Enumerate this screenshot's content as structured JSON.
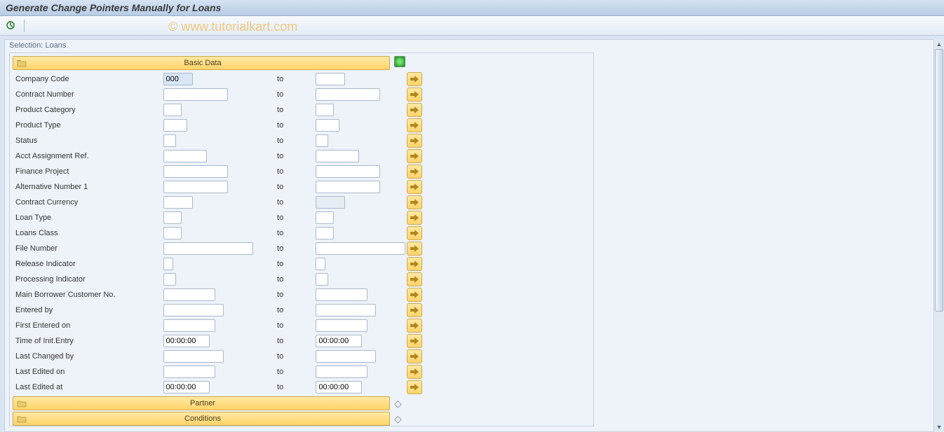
{
  "title": "Generate Change Pointers Manually for Loans",
  "watermark": "© www.tutorialkart.com",
  "group": {
    "title": "Selection: Loans",
    "sections": {
      "basic_data": {
        "label": "Basic Data",
        "expanded": true
      },
      "partner": {
        "label": "Partner",
        "expanded": false
      },
      "conditions": {
        "label": "Conditions",
        "expanded": false
      }
    }
  },
  "to_label": "to",
  "rows": {
    "company_code": {
      "label": "Company Code",
      "from": "000",
      "to": "",
      "wfrom": 42,
      "wto": 42
    },
    "contract_number": {
      "label": "Contract Number",
      "from": "",
      "to": "",
      "wfrom": 92,
      "wto": 92
    },
    "product_category": {
      "label": "Product Category",
      "from": "",
      "to": "",
      "wfrom": 26,
      "wto": 26
    },
    "product_type": {
      "label": "Product Type",
      "from": "",
      "to": "",
      "wfrom": 34,
      "wto": 34
    },
    "status": {
      "label": "Status",
      "from": "",
      "to": "",
      "wfrom": 18,
      "wto": 18
    },
    "acct_assign": {
      "label": "Acct Assignment Ref.",
      "from": "",
      "to": "",
      "wfrom": 62,
      "wto": 62
    },
    "finance_project": {
      "label": "Finance Project",
      "from": "",
      "to": "",
      "wfrom": 92,
      "wto": 92
    },
    "alt_number1": {
      "label": "Alternative Number 1",
      "from": "",
      "to": "",
      "wfrom": 92,
      "wto": 92
    },
    "contract_curr": {
      "label": "Contract Currency",
      "from": "",
      "to": "",
      "wfrom": 42,
      "wto": 42,
      "to_disabled": true
    },
    "loan_type": {
      "label": "Loan Type",
      "from": "",
      "to": "",
      "wfrom": 26,
      "wto": 26
    },
    "loans_class": {
      "label": "Loans Class",
      "from": "",
      "to": "",
      "wfrom": 26,
      "wto": 26
    },
    "file_number": {
      "label": "File Number",
      "from": "",
      "to": "",
      "wfrom": 128,
      "wto": 128
    },
    "release_ind": {
      "label": "Release Indicator",
      "from": "",
      "to": "",
      "wfrom": 14,
      "wto": 14
    },
    "processing_ind": {
      "label": "Processing Indicator",
      "from": "",
      "to": "",
      "wfrom": 18,
      "wto": 18
    },
    "main_borrower": {
      "label": "Main Borrower Customer No.",
      "from": "",
      "to": "",
      "wfrom": 74,
      "wto": 74
    },
    "entered_by": {
      "label": "Entered by",
      "from": "",
      "to": "",
      "wfrom": 86,
      "wto": 86
    },
    "first_entered": {
      "label": "First Entered on",
      "from": "",
      "to": "",
      "wfrom": 74,
      "wto": 74
    },
    "time_init": {
      "label": "Time of Init.Entry",
      "from": "00:00:00",
      "to": "00:00:00",
      "wfrom": 66,
      "wto": 66
    },
    "last_changed_by": {
      "label": "Last Changed by",
      "from": "",
      "to": "",
      "wfrom": 86,
      "wto": 86
    },
    "last_edited_on": {
      "label": "Last Edited on",
      "from": "",
      "to": "",
      "wfrom": 74,
      "wto": 74
    },
    "last_edited_at": {
      "label": "Last Edited at",
      "from": "00:00:00",
      "to": "00:00:00",
      "wfrom": 66,
      "wto": 66
    }
  }
}
